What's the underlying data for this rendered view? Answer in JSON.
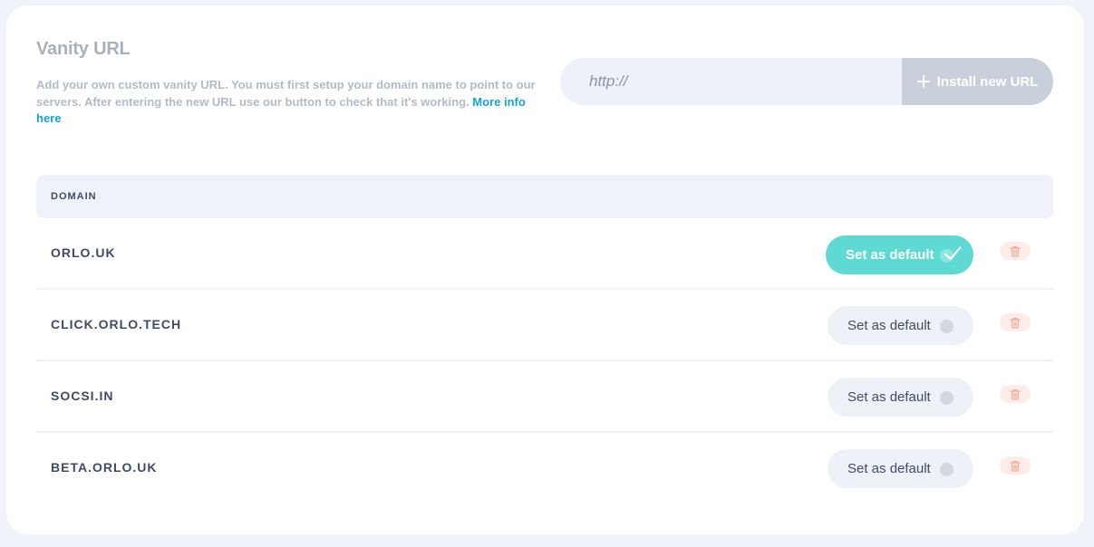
{
  "header": {
    "title": "Vanity URL",
    "description": "Add your own custom vanity URL. You must first setup your domain name to point to our servers. After entering the new URL use our button to check that it's working. ",
    "more_link": "More info here"
  },
  "url_form": {
    "placeholder": "http://",
    "value": "",
    "install_label": "Install new URL"
  },
  "table": {
    "column_header": "DOMAIN",
    "rows": [
      {
        "domain": "ORLO.UK",
        "button_label": "Set as default",
        "is_default": true
      },
      {
        "domain": "CLICK.ORLO.TECH",
        "button_label": "Set as default",
        "is_default": false
      },
      {
        "domain": "SOCSI.IN",
        "button_label": "Set as default",
        "is_default": false
      },
      {
        "domain": "BETA.ORLO.UK",
        "button_label": "Set as default",
        "is_default": false
      }
    ]
  },
  "icons": {
    "install": "plus-icon",
    "delete": "trash-icon",
    "default_selected": "check-icon",
    "default_unselected": "radio-dot-icon"
  },
  "colors": {
    "accent": "#5ed9d3",
    "link": "#14a4d4",
    "delete": "#f0a89a",
    "text": "#3f4b66"
  }
}
